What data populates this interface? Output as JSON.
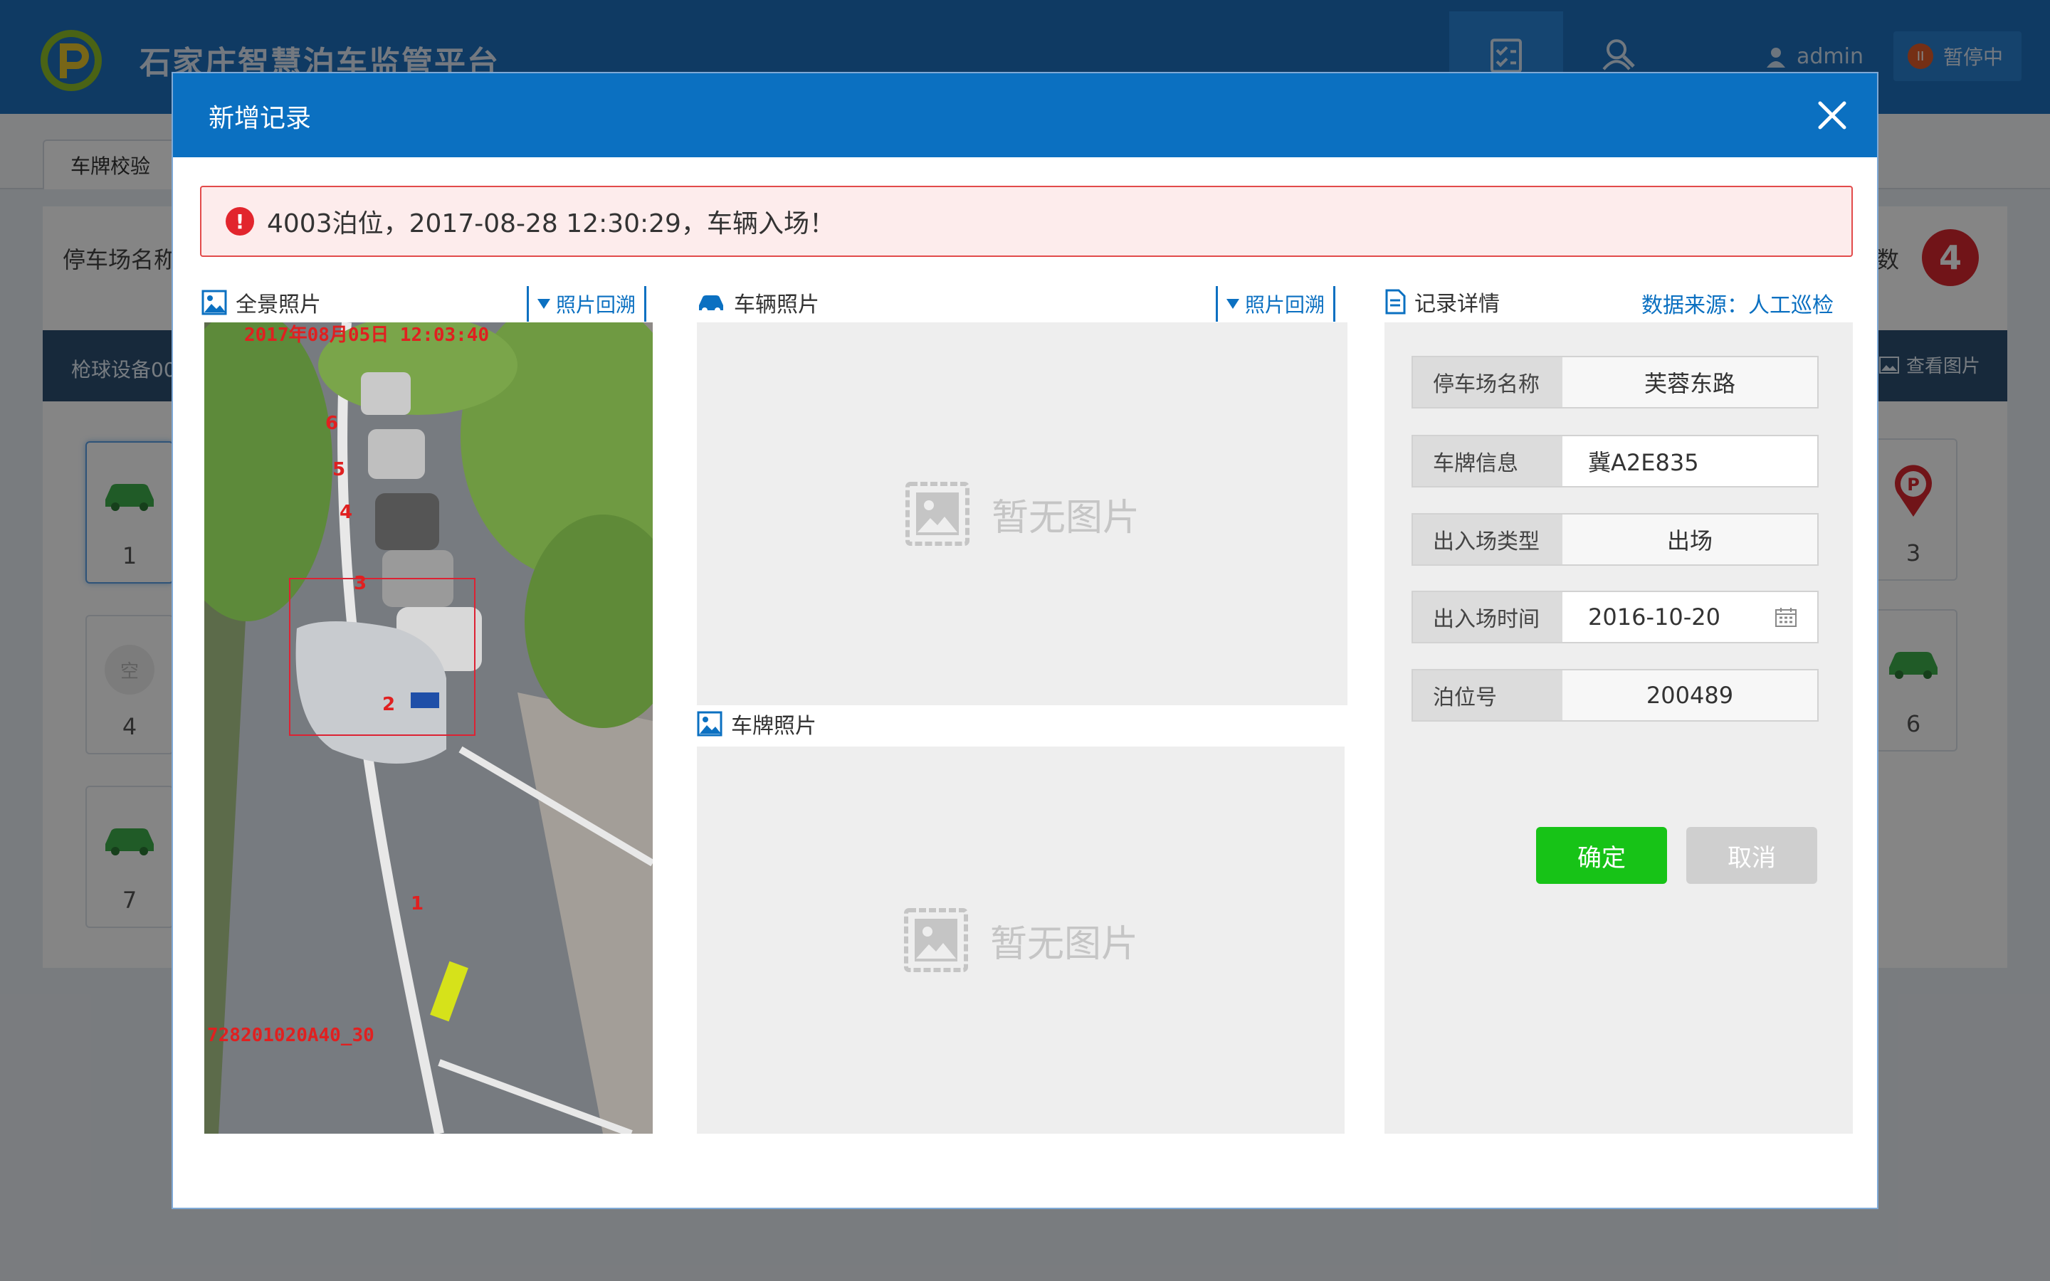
{
  "app": {
    "title": "石家庄智慧泊车监管平台",
    "user": "admin",
    "pause_label": "暂停中",
    "subtab": "车牌校验",
    "lot_label": "停车场名称",
    "count_label": "数",
    "count_value": "4",
    "device_name": "枪球设备00",
    "view_photo_label": "查看图片",
    "slots": [
      {
        "num": "1",
        "icon": "car-icon"
      },
      {
        "num": "4",
        "icon": "empty-slot-icon"
      },
      {
        "num": "7",
        "icon": "car-icon"
      },
      {
        "num": "3",
        "icon": "parking-pin-icon"
      },
      {
        "num": "6",
        "icon": "car-icon"
      }
    ],
    "empty_slot_char": "空"
  },
  "modal": {
    "title": "新增记录",
    "alert": "4003泊位，2017-08-28 12:30:29，车辆入场！",
    "panorama": {
      "title": "全景照片",
      "trace_label": "照片回溯",
      "timestamp": "2017年08月05日 12:03:40",
      "device_code": "728201020A40_30",
      "slot_marks": [
        "6",
        "5",
        "4",
        "3",
        "2",
        "1"
      ]
    },
    "vehicle": {
      "title": "车辆照片",
      "trace_label": "照片回溯",
      "placeholder": "暂无图片"
    },
    "plate": {
      "title": "车牌照片",
      "placeholder": "暂无图片"
    },
    "detail": {
      "title": "记录详情",
      "source": "数据来源：人工巡检",
      "fields": [
        {
          "label": "停车场名称",
          "value": "芙蓉东路"
        },
        {
          "label": "车牌信息",
          "value": "冀A2E835"
        },
        {
          "label": "出入场类型",
          "value": "出场"
        },
        {
          "label": "出入场时间",
          "value": "2016-10-20"
        },
        {
          "label": "泊位号",
          "value": "200489"
        }
      ],
      "confirm": "确定",
      "cancel": "取消"
    }
  },
  "colors": {
    "header_blue": "#0b70c1",
    "alert_red": "#e2252d",
    "confirm_green": "#17c317"
  }
}
